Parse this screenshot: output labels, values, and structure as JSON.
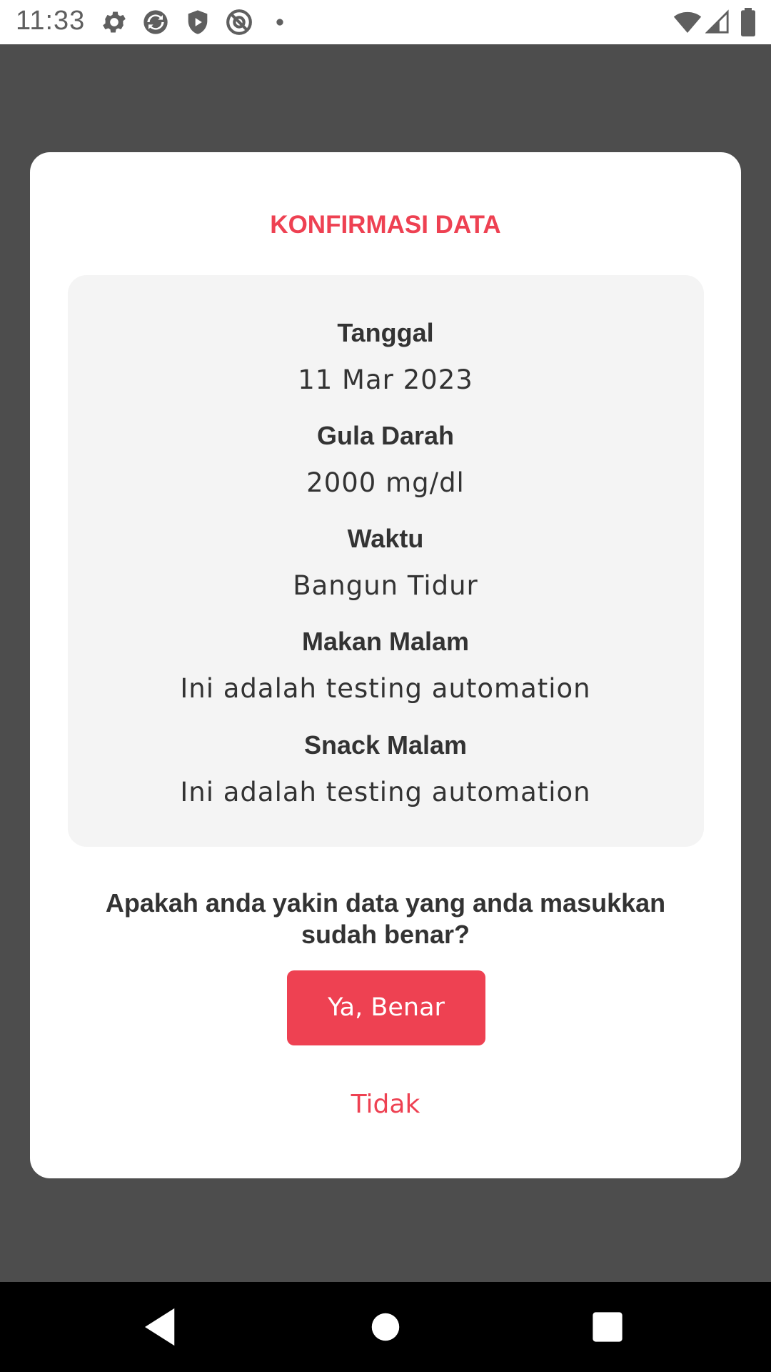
{
  "status_bar": {
    "time": "11:33",
    "icons_left": [
      "gear-icon",
      "sync-icon",
      "shield-play-icon",
      "at-sign-icon",
      "dot-icon"
    ],
    "icons_right": [
      "wifi-icon",
      "signal-icon",
      "battery-icon"
    ]
  },
  "dialog": {
    "title": "KONFIRMASI DATA",
    "fields": [
      {
        "label": "Tanggal",
        "value": "11 Mar 2023"
      },
      {
        "label": "Gula Darah",
        "value": "2000 mg/dl"
      },
      {
        "label": "Waktu",
        "value": "Bangun Tidur"
      },
      {
        "label": "Makan Malam",
        "value": "Ini adalah testing automation"
      },
      {
        "label": "Snack Malam",
        "value": "Ini adalah testing automation"
      }
    ],
    "question": "Apakah anda yakin data yang anda masukkan sudah benar?",
    "confirm_label": "Ya, Benar",
    "cancel_label": "Tidak"
  },
  "nav_bar": {
    "buttons": [
      "back-icon",
      "home-icon",
      "recents-icon"
    ]
  },
  "colors": {
    "accent": "#ee4152",
    "overlay": "#4d4d4d",
    "panel": "#f4f4f4"
  }
}
